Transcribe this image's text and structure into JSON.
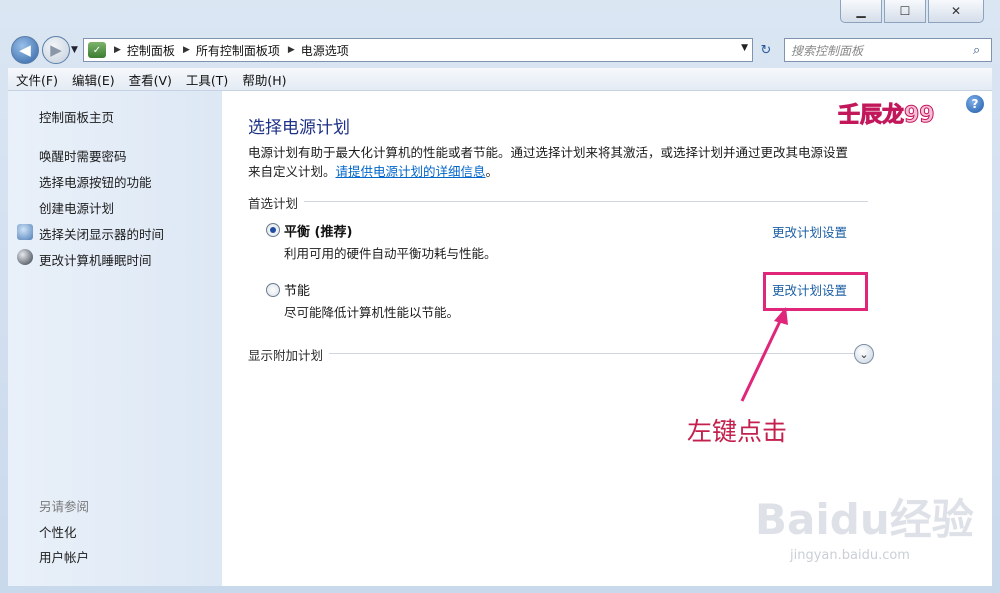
{
  "window": {
    "min_symbol": "▁",
    "max_symbol": "☐",
    "close_symbol": "✕"
  },
  "address": {
    "crumbs": [
      "控制面板",
      "所有控制面板项",
      "电源选项"
    ],
    "search_placeholder": "搜索控制面板"
  },
  "menu": [
    "文件(F)",
    "编辑(E)",
    "查看(V)",
    "工具(T)",
    "帮助(H)"
  ],
  "sidebar": {
    "home": "控制面板主页",
    "links": [
      "唤醒时需要密码",
      "选择电源按钮的功能",
      "创建电源计划",
      "选择关闭显示器的时间",
      "更改计算机睡眠时间"
    ],
    "see_also_title": "另请参阅",
    "see_also": [
      "个性化",
      "用户帐户"
    ]
  },
  "main": {
    "title": "选择电源计划",
    "desc_line1": "电源计划有助于最大化计算机的性能或者节能。通过选择计划来将其激活，或选择计划并通过更改其电源设置",
    "desc_line2_prefix": "来自定义计划。",
    "desc_link": "请提供电源计划的详细信息",
    "desc_line2_suffix": "。",
    "preferred_title": "首选计划",
    "plans": [
      {
        "name": "平衡 (推荐)",
        "desc": "利用可用的硬件自动平衡功耗与性能。",
        "link": "更改计划设置",
        "selected": true
      },
      {
        "name": "节能",
        "desc": "尽可能降低计算机性能以节能。",
        "link": "更改计划设置",
        "selected": false
      }
    ],
    "more_plans": "显示附加计划"
  },
  "overlay": {
    "watermark": "壬辰龙99",
    "annotation": "左键点击",
    "annotation_color": "#c4204e",
    "logo_text": "Baidu经验",
    "logo_sub": "jingyan.baidu.com"
  },
  "icons": {
    "help": "?",
    "search": "⌕",
    "refresh": "↻",
    "expand": "⌄"
  }
}
